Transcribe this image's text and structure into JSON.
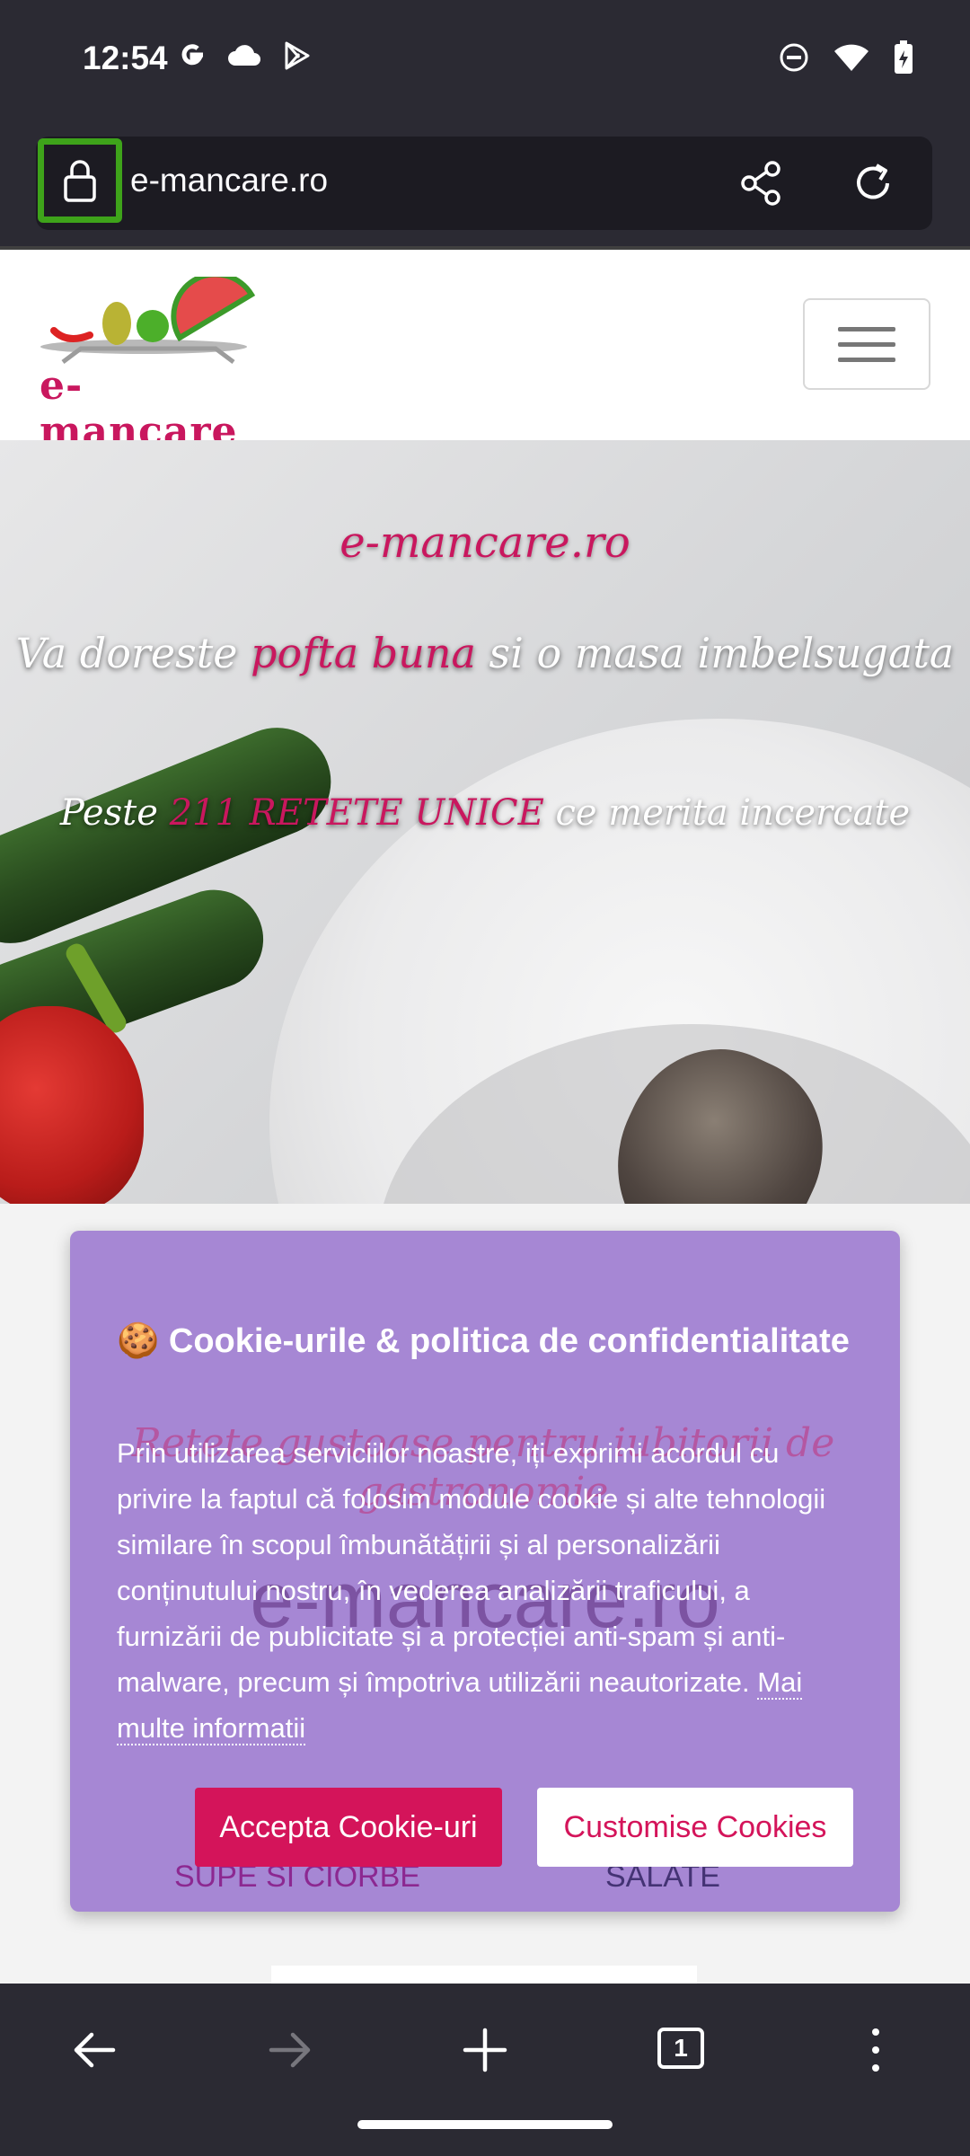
{
  "status_bar": {
    "time": "12:54",
    "left_icons": [
      "google-icon",
      "cloud-icon",
      "play-store-icon"
    ],
    "right_icons": [
      "do-not-disturb-icon",
      "wifi-icon",
      "battery-charging-icon"
    ]
  },
  "browser": {
    "url": "e-mancare.ro",
    "icons": [
      "lock-icon",
      "share-icon",
      "reload-icon"
    ]
  },
  "site": {
    "logo_text": "e-mancare",
    "hero": {
      "title": "e-mancare.ro",
      "line1_before": "Va doreste ",
      "line1_accent": "pofta buna",
      "line1_after": " si o masa imbelsugata",
      "line2_before": "Peste ",
      "line2_accent": "211 RETETE UNICE",
      "line2_after": " ce merita incercate"
    },
    "behind_overlay": {
      "tagline": "Retete gustoase pentru iubitorii de gastronomie",
      "brand": "e-mancare.ro",
      "category_1": "SUPE SI CIORBE",
      "category_2": "SALATE"
    }
  },
  "cookie_banner": {
    "title": "🍪 Cookie-urile & politica de confidentialitate",
    "body": "Prin utilizarea serviciilor noastre, iți exprimi acordul cu privire la faptul că folosim module cookie și alte tehnologii similare în scopul îmbunătățirii și al personalizării conținutului nostru, în vederea analizării traficului, a furnizării de publicitate și a protecției anti-spam și anti-malware, precum și împotriva utilizării neautorizate.",
    "link": "Mai multe informatii",
    "accept_label": "Accepta Cookie-uri",
    "customise_label": "Customise Cookies"
  },
  "bottom_nav": {
    "tabs_count": "1",
    "icons": [
      "back-icon",
      "forward-icon",
      "new-tab-icon",
      "tabs-icon",
      "more-icon"
    ]
  },
  "colors": {
    "brand": "#c9175e",
    "cookie_bg": "#a687d4",
    "accept_bg": "#d4145a",
    "lock_highlight": "#3ea31a",
    "browser_chrome": "#2b2a33"
  }
}
